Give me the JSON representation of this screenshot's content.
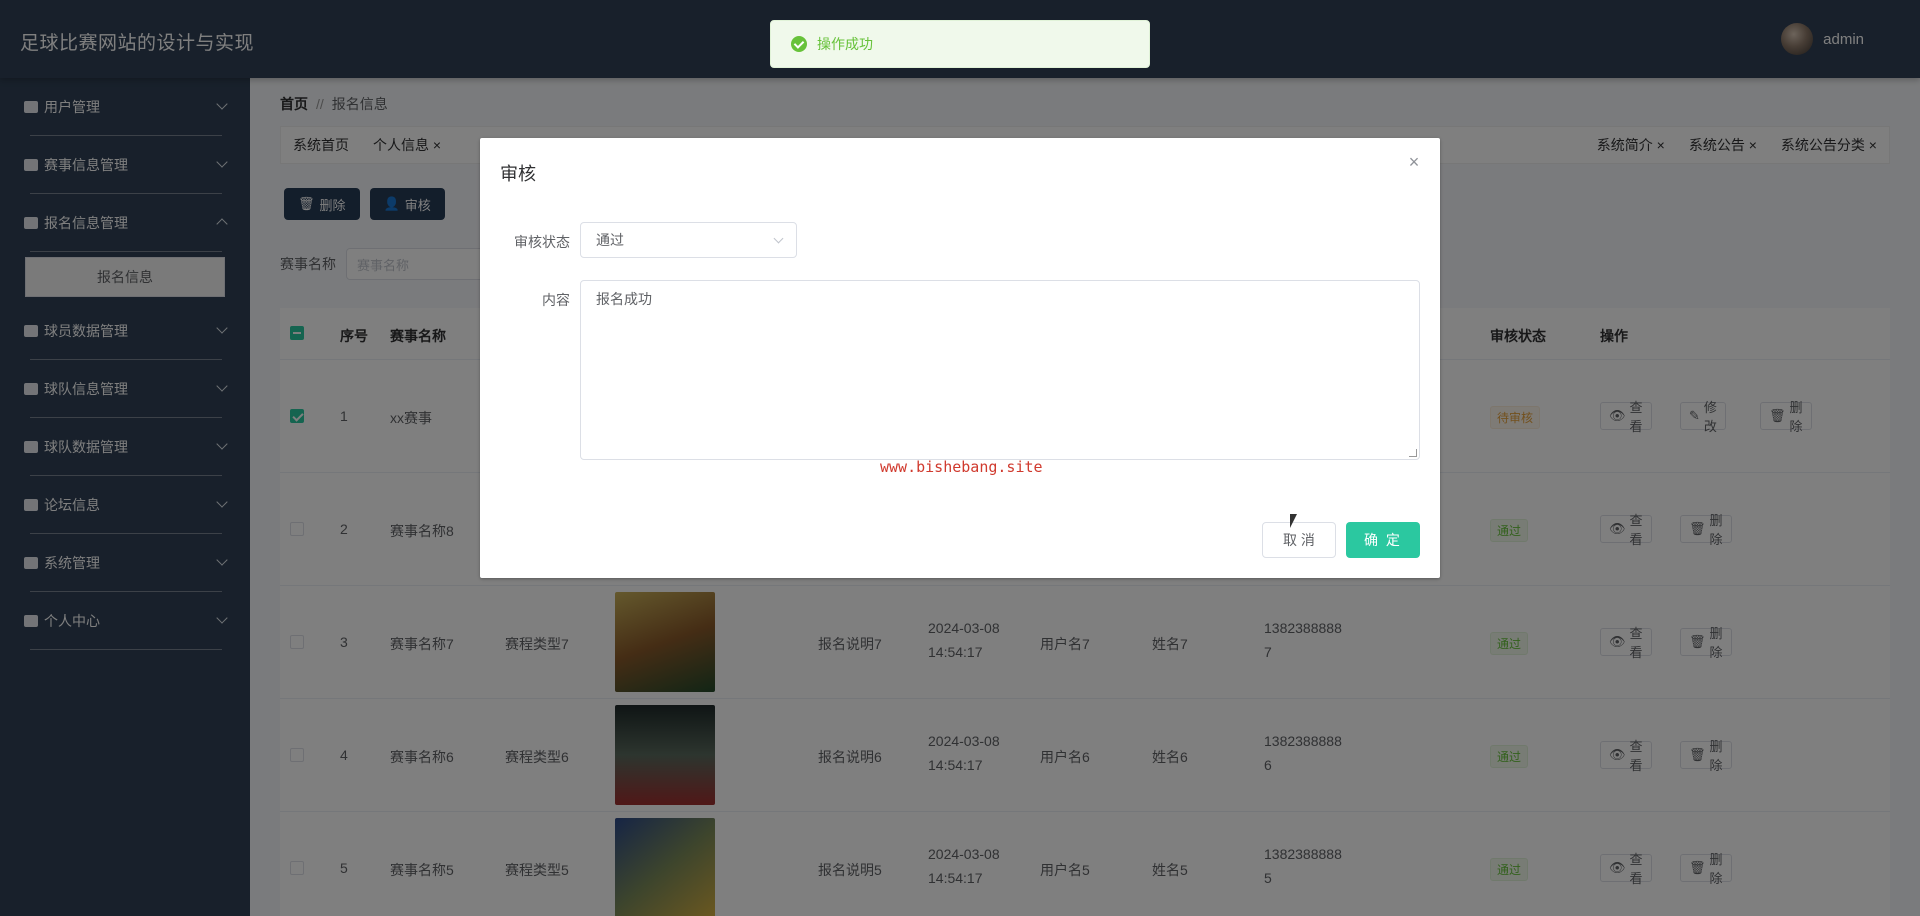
{
  "topbar": {
    "title": "足球比赛网站的设计与实现",
    "username": "admin"
  },
  "sidebar": {
    "items": [
      {
        "label": "用户管理",
        "expanded": false
      },
      {
        "label": "赛事信息管理",
        "expanded": false
      },
      {
        "label": "报名信息管理",
        "expanded": true
      },
      {
        "label": "球员数据管理",
        "expanded": false
      },
      {
        "label": "球队信息管理",
        "expanded": false
      },
      {
        "label": "球队数据管理",
        "expanded": false
      },
      {
        "label": "论坛信息",
        "expanded": false
      },
      {
        "label": "系统管理",
        "expanded": false
      },
      {
        "label": "个人中心",
        "expanded": false
      }
    ],
    "submenu_active": "报名信息"
  },
  "breadcrumb": {
    "home": "首页",
    "sep": "//",
    "current": "报名信息"
  },
  "tabs": {
    "left": [
      "系统首页",
      "个人信息 ×"
    ],
    "right": [
      "系统简介 ×",
      "系统公告 ×",
      "系统公告分类 ×"
    ]
  },
  "toolbar": {
    "delete_label": "删除",
    "audit_label": "审核"
  },
  "search": {
    "label": "赛事名称",
    "placeholder": "赛事名称"
  },
  "table": {
    "headers": {
      "index": "序号",
      "name": "赛事名称",
      "audit": "审核状态",
      "ops": "操作"
    },
    "rows": [
      {
        "no": "1",
        "name": "xx赛事",
        "status": "待审核",
        "ops": [
          "查看",
          "修改",
          "删除"
        ]
      },
      {
        "no": "2",
        "name": "赛事名称8",
        "status": "通过",
        "ops": [
          "查看",
          "删除"
        ]
      },
      {
        "no": "3",
        "name": "赛事名称7",
        "type": "赛程类型7",
        "desc": "报名说明7",
        "time1": "2024-03-08",
        "time2": "14:54:17",
        "user": "用户名7",
        "realname": "姓名7",
        "phone1": "1382388888",
        "phone2": "7",
        "status": "通过",
        "ops": [
          "查看",
          "删除"
        ]
      },
      {
        "no": "4",
        "name": "赛事名称6",
        "type": "赛程类型6",
        "desc": "报名说明6",
        "time1": "2024-03-08",
        "time2": "14:54:17",
        "user": "用户名6",
        "realname": "姓名6",
        "phone1": "1382388888",
        "phone2": "6",
        "status": "通过",
        "ops": [
          "查看",
          "删除"
        ]
      },
      {
        "no": "5",
        "name": "赛事名称5",
        "type": "赛程类型5",
        "desc": "报名说明5",
        "time1": "2024-03-08",
        "time2": "14:54:17",
        "user": "用户名5",
        "realname": "姓名5",
        "phone1": "1382388888",
        "phone2": "5",
        "status": "通过",
        "ops": [
          "查看",
          "删除"
        ]
      }
    ]
  },
  "toast": {
    "message": "操作成功"
  },
  "dialog": {
    "title": "审核",
    "status_label": "审核状态",
    "status_value": "通过",
    "content_label": "内容",
    "content_value": "报名成功",
    "watermark": "www.bishebang.site",
    "cancel_label": "取 消",
    "ok_label": "确 定"
  }
}
